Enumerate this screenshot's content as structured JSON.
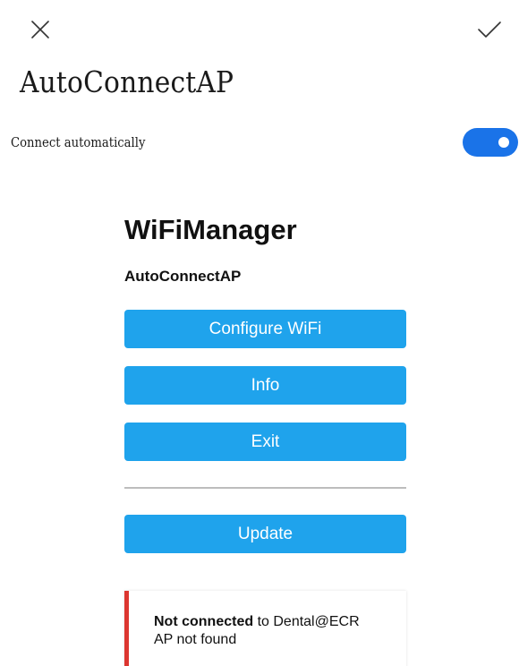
{
  "topbar": {
    "close_icon": "close-icon",
    "confirm_icon": "check-icon"
  },
  "header": {
    "title": "AutoConnectAP"
  },
  "auto_connect": {
    "label": "Connect automatically",
    "enabled": true,
    "accent_color": "#1a73e8"
  },
  "portal": {
    "heading": "WiFiManager",
    "subtitle": "AutoConnectAP",
    "button_color": "#1fa3ec",
    "buttons": {
      "configure": "Configure WiFi",
      "info": "Info",
      "exit": "Exit",
      "update": "Update"
    },
    "status": {
      "bold": "Not connected",
      "rest": " to Dental@ECR",
      "line2": "AP not found",
      "accent_color": "#dc3630"
    }
  }
}
